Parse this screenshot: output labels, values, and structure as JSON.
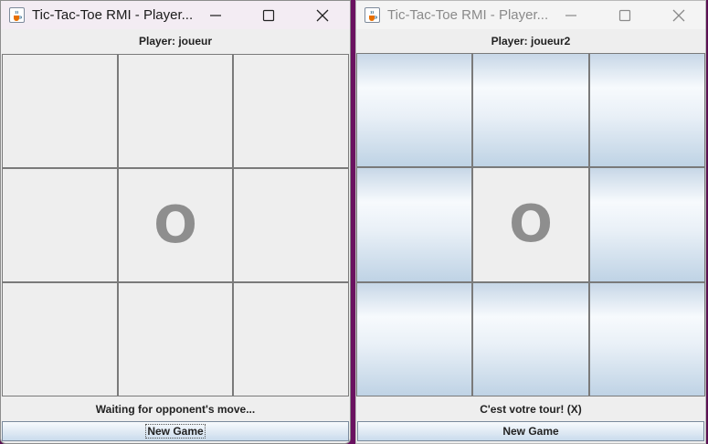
{
  "windows": [
    {
      "title": "Tic-Tac-Toe RMI - Player...",
      "player_label": "Player: joueur",
      "board": [
        "",
        "",
        "",
        "",
        "O",
        "",
        "",
        "",
        ""
      ],
      "status": "Waiting for opponent's move...",
      "new_game_label": "New Game",
      "focused": true
    },
    {
      "title": "Tic-Tac-Toe RMI - Player...",
      "player_label": "Player: joueur2",
      "board": [
        "",
        "",
        "",
        "",
        "O",
        "",
        "",
        "",
        ""
      ],
      "status": "C'est votre tour! (X)",
      "new_game_label": "New Game",
      "focused": false
    }
  ],
  "icons": {
    "app": "java-cup-icon",
    "minimize": "minimize-icon",
    "maximize": "maximize-icon",
    "close": "close-icon"
  },
  "colors": {
    "desktop": "#5a0f52",
    "window_bg": "#eeeeee",
    "mark": "#8e8e8e",
    "active_cell_highlight": "#c7d7e7"
  }
}
